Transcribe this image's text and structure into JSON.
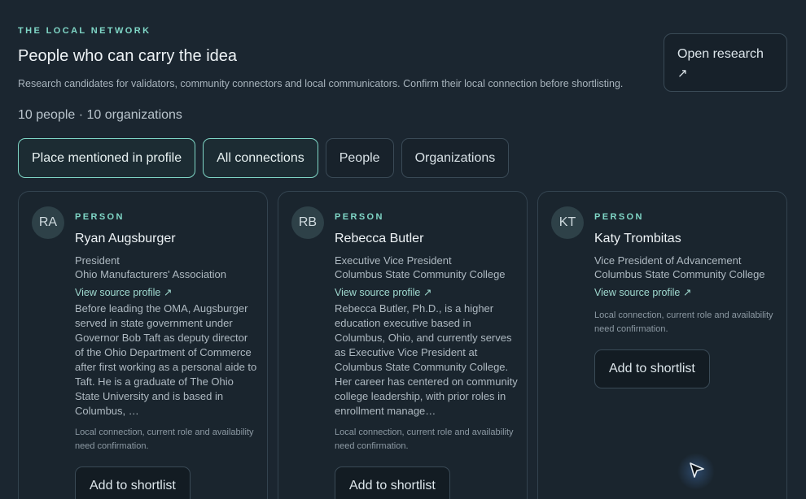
{
  "header": {
    "eyebrow": "THE LOCAL NETWORK",
    "title": "People who can carry the idea",
    "description": "Research candidates for validators, community connectors and local communicators. Confirm their local connection before shortlisting.",
    "counts": "10 people · 10 organizations",
    "open_research_label": "Open research",
    "open_research_arrow": "↗"
  },
  "filters": [
    {
      "label": "Place mentioned in profile",
      "active": true
    },
    {
      "label": "All connections",
      "active": true
    },
    {
      "label": "People",
      "active": false
    },
    {
      "label": "Organizations",
      "active": false
    }
  ],
  "cards": [
    {
      "initials": "RA",
      "kind": "PERSON",
      "name": "Ryan Augsburger",
      "role": "President",
      "org": "Ohio Manufacturers' Association",
      "source_label": "View source profile ↗",
      "bio": "Before leading the OMA, Augsburger served in state government under Governor Bob Taft as deputy director of the Ohio Department of Commerce after first working as a personal aide to Taft. He is a graduate of The Ohio State University and is based in Columbus, …",
      "note": "Local connection, current role and availability need confirmation.",
      "button_label": "Add to shortlist"
    },
    {
      "initials": "RB",
      "kind": "PERSON",
      "name": "Rebecca Butler",
      "role": "Executive Vice President",
      "org": "Columbus State Community College",
      "source_label": "View source profile ↗",
      "bio": "Rebecca Butler, Ph.D., is a higher education executive based in Columbus, Ohio, and currently serves as Executive Vice President at Columbus State Community College. Her career has centered on community college leadership, with prior roles in enrollment manage…",
      "note": "Local connection, current role and availability need confirmation.",
      "button_label": "Add to shortlist"
    },
    {
      "initials": "KT",
      "kind": "PERSON",
      "name": "Katy Trombitas",
      "role": "Vice President of Advancement",
      "org": "Columbus State Community College",
      "source_label": "View source profile ↗",
      "bio": "",
      "note": "Local connection, current role and availability need confirmation.",
      "button_label": "Add to shortlist"
    }
  ],
  "colors": {
    "accent": "#7fd6c6",
    "background": "#1b2630",
    "card": "#1a252e"
  }
}
